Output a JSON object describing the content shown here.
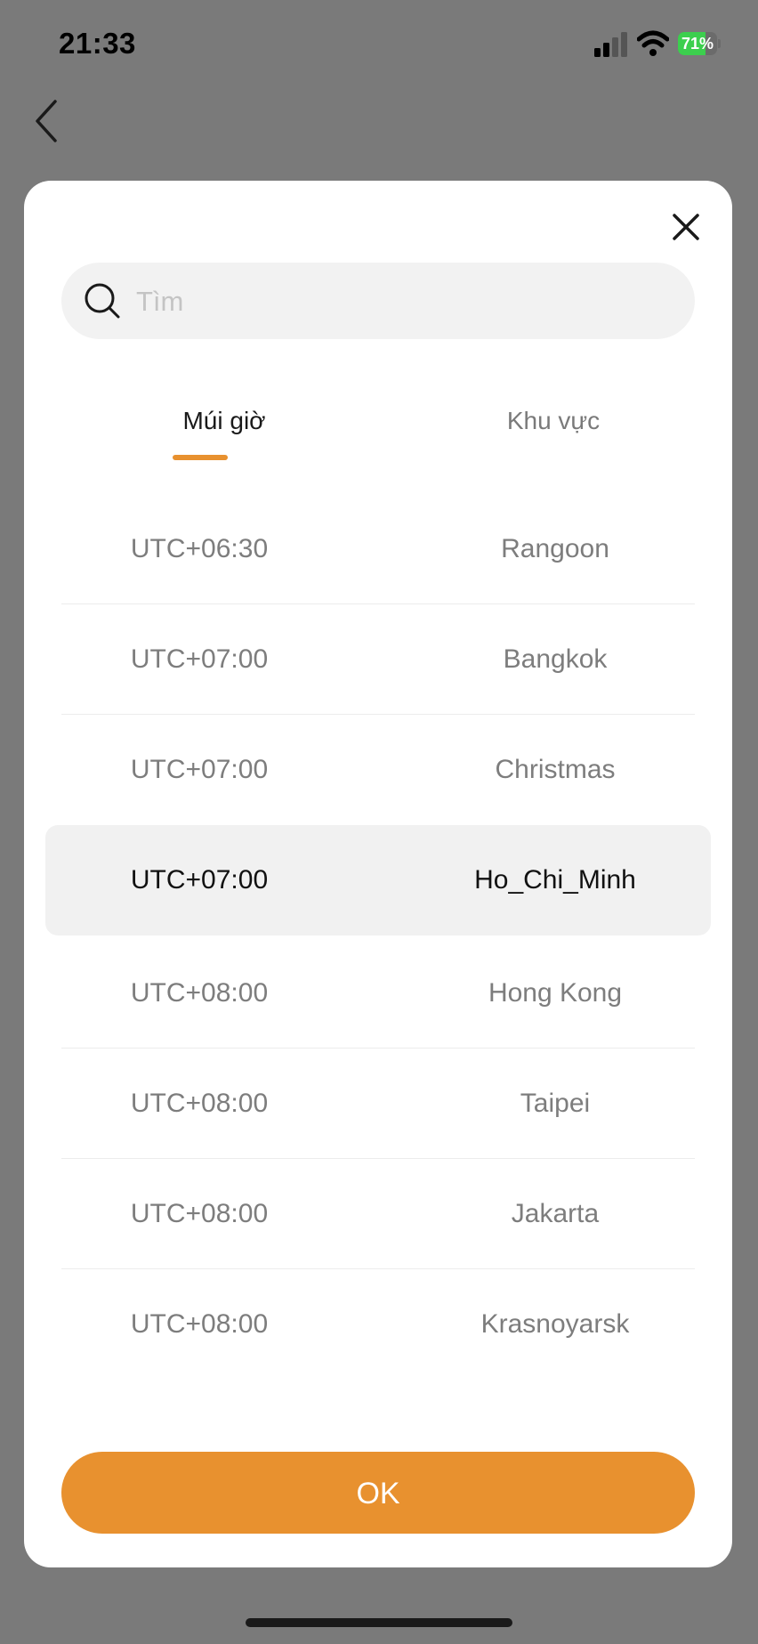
{
  "status_bar": {
    "time": "21:33",
    "battery": {
      "percent": 71,
      "label": "71%",
      "color": "#3ccf4e"
    },
    "icons": [
      "signal-icon",
      "wifi-icon",
      "battery-icon"
    ]
  },
  "nav": {
    "back_icon": "chevron-left-icon"
  },
  "modal": {
    "close_icon": "close-icon",
    "search": {
      "placeholder": "Tìm",
      "value": "",
      "icon": "search-icon"
    },
    "tabs": [
      {
        "label": "Múi giờ",
        "active": true
      },
      {
        "label": "Khu vực",
        "active": false
      }
    ],
    "timezones": [
      {
        "offset": "UTC+06:30",
        "city": "Rangoon",
        "selected": false
      },
      {
        "offset": "UTC+07:00",
        "city": "Bangkok",
        "selected": false
      },
      {
        "offset": "UTC+07:00",
        "city": "Christmas",
        "selected": false
      },
      {
        "offset": "UTC+07:00",
        "city": "Ho_Chi_Minh",
        "selected": true
      },
      {
        "offset": "UTC+08:00",
        "city": "Hong Kong",
        "selected": false
      },
      {
        "offset": "UTC+08:00",
        "city": "Taipei",
        "selected": false
      },
      {
        "offset": "UTC+08:00",
        "city": "Jakarta",
        "selected": false
      },
      {
        "offset": "UTC+08:00",
        "city": "Krasnoyarsk",
        "selected": false
      }
    ],
    "ok_label": "OK"
  },
  "colors": {
    "accent": "#e8912f",
    "overlay": "#7a7a7a",
    "selected_row": "#f1f1f1"
  }
}
